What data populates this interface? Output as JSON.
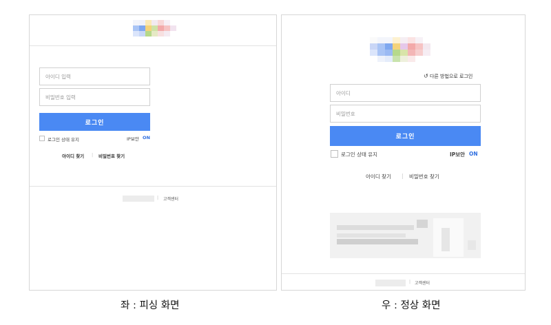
{
  "left": {
    "id_placeholder": "아이디 입력",
    "pw_placeholder": "비밀번호 입력",
    "login_label": "로그인",
    "keep_login_label": "로그인 상태 유지",
    "ip_security_label": "IP보안",
    "ip_security_state": "ON",
    "find_id_label": "아이디 찾기",
    "divider": "|",
    "find_pw_label": "비밀번호 찾기",
    "footer_link": "고객센터",
    "footer_divider": "|"
  },
  "right": {
    "other_method_label": "다른 방법으로 로그인",
    "id_placeholder": "아이디",
    "pw_placeholder": "비밀번호",
    "login_label": "로그인",
    "keep_login_label": "로그인 상태 유지",
    "ip_security_label": "IP보안",
    "ip_security_state": "ON",
    "find_id_label": "아이디 찾기",
    "divider": "|",
    "find_pw_label": "비밀번호 찾기",
    "footer_link": "고객센터",
    "footer_divider": "|"
  },
  "captions": {
    "left": "좌 : 피싱 화면",
    "right": "우 : 정상 화면"
  },
  "colors": {
    "accent": "#4a89f3",
    "on_text": "#2f6fe0",
    "logo_pixels": [
      "#a9c4f5",
      "#7fa8f0",
      "#f4d37a",
      "#b6d98a",
      "#f3a9a9",
      "#f6c3c3",
      "#c9d6f6",
      "#e6c8e9"
    ]
  }
}
